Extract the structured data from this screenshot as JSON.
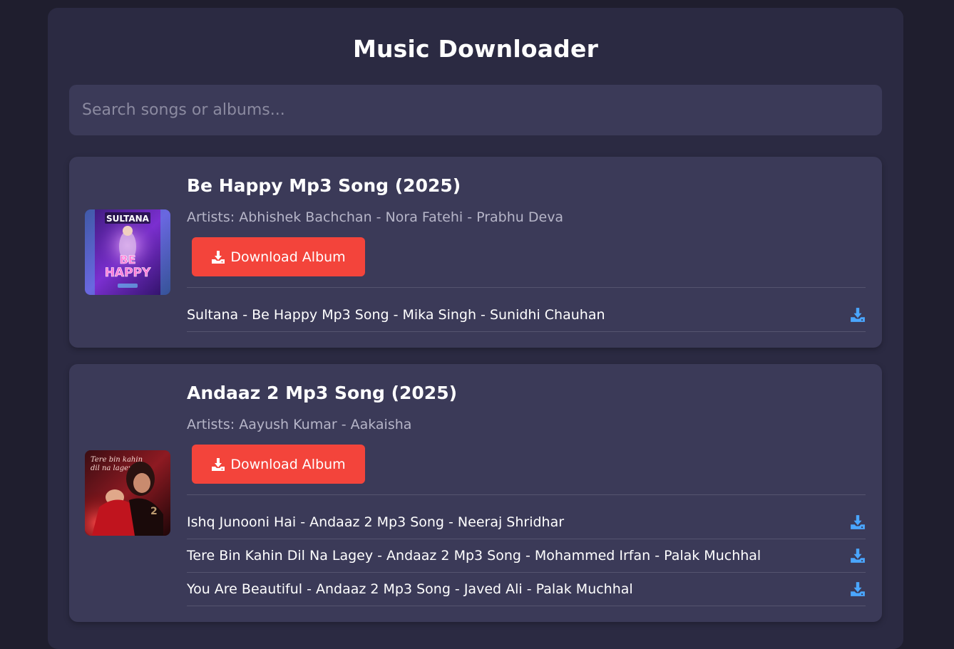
{
  "app": {
    "title": "Music Downloader"
  },
  "search": {
    "placeholder": "Search songs or albums..."
  },
  "colors": {
    "background": "#1f1e2e",
    "panel": "#2b2a42",
    "card": "#3b3a58",
    "accent_button": "#f3443b",
    "track_download_icon": "#4aa6ff"
  },
  "albums": [
    {
      "title": "Be Happy Mp3 Song (2025)",
      "artists": "Artists: Abhishek Bachchan - Nora Fatehi - Prabhu Deva",
      "cover_icon": "album-cover-be-happy",
      "download_label": "Download Album",
      "tracks": [
        {
          "name": "Sultana - Be Happy Mp3 Song - Mika Singh - Sunidhi Chauhan",
          "icon": "download-icon"
        }
      ]
    },
    {
      "title": "Andaaz 2 Mp3 Song (2025)",
      "artists": "Artists: Aayush Kumar - Aakaisha",
      "cover_icon": "album-cover-andaaz-2",
      "download_label": "Download Album",
      "tracks": [
        {
          "name": "Ishq Junooni Hai - Andaaz 2 Mp3 Song - Neeraj Shridhar",
          "icon": "download-icon"
        },
        {
          "name": "Tere Bin Kahin Dil Na Lagey - Andaaz 2 Mp3 Song - Mohammed Irfan - Palak Muchhal",
          "icon": "download-icon"
        },
        {
          "name": "You Are Beautiful - Andaaz 2 Mp3 Song - Javed Ali - Palak Muchhal",
          "icon": "download-icon"
        }
      ]
    }
  ]
}
